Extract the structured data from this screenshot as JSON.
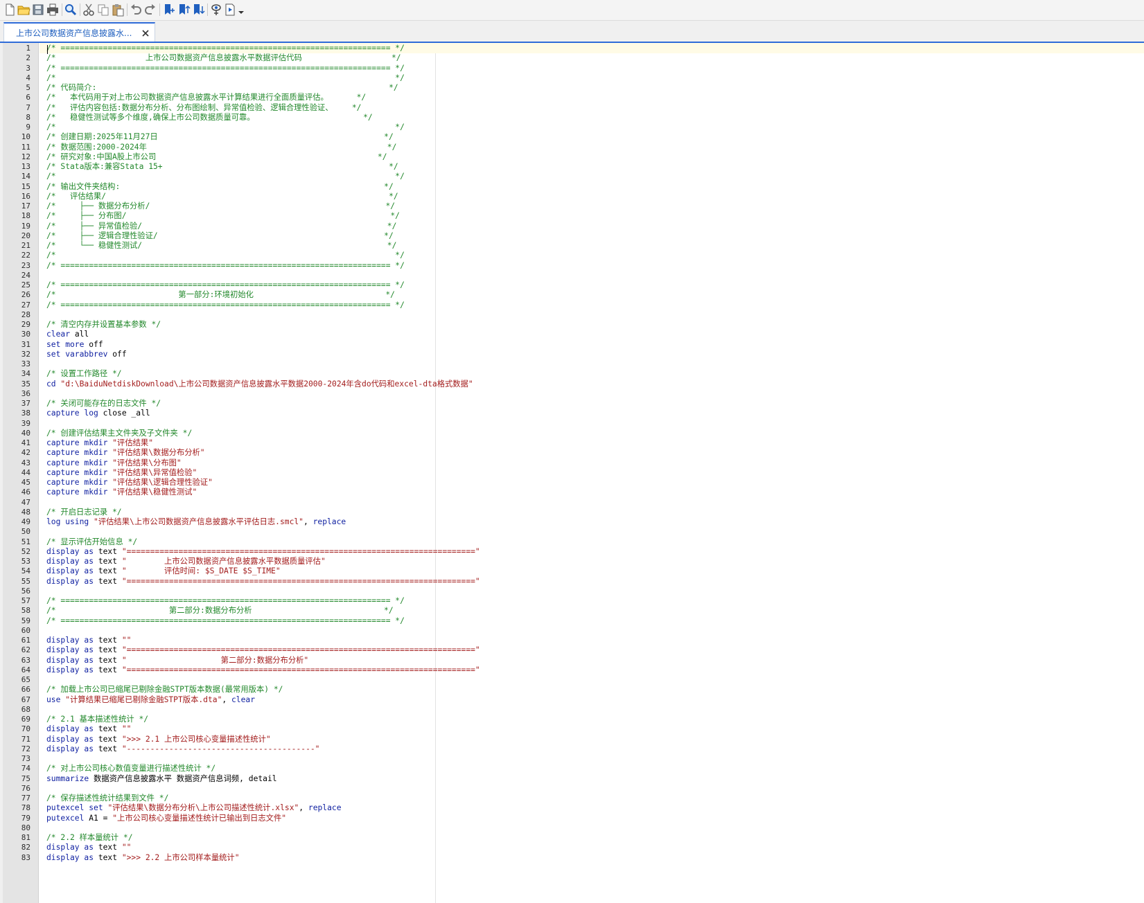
{
  "toolbar": {
    "buttons": [
      {
        "name": "new-file-icon"
      },
      {
        "name": "open-folder-icon"
      },
      {
        "name": "save-icon"
      },
      {
        "name": "print-icon"
      },
      {
        "name": "find-icon"
      },
      {
        "name": "cut-icon"
      },
      {
        "name": "copy-icon"
      },
      {
        "name": "paste-icon"
      },
      {
        "name": "undo-icon"
      },
      {
        "name": "redo-icon"
      },
      {
        "name": "toggle-bookmark-icon"
      },
      {
        "name": "previous-bookmark-icon"
      },
      {
        "name": "next-bookmark-icon"
      },
      {
        "name": "view-data-icon"
      },
      {
        "name": "run-dropdown-icon"
      }
    ]
  },
  "tab": {
    "title": "上市公司数据资产信息披露水...",
    "close_glyph": "✕"
  },
  "colors": {
    "comment": "#22882b",
    "keyword": "#0d1ea0",
    "string": "#a31c1c",
    "plain": "#000000",
    "accent": "#2e6bd8",
    "current_line": "#fffbe6"
  },
  "editor": {
    "lines": [
      {
        "n": "1",
        "segs": [
          {
            "t": "c",
            "v": "/* ====================================================================== */"
          }
        ]
      },
      {
        "n": "2",
        "segs": [
          {
            "t": "c",
            "v": "/*                   上市公司数据资产信息披露水平数据评估代码                   */"
          }
        ]
      },
      {
        "n": "3",
        "segs": [
          {
            "t": "c",
            "v": "/* ====================================================================== */"
          }
        ]
      },
      {
        "n": "4",
        "segs": [
          {
            "t": "c",
            "v": "/*                                                                        */"
          }
        ]
      },
      {
        "n": "5",
        "segs": [
          {
            "t": "c",
            "v": "/* 代码简介:                                                              */"
          }
        ]
      },
      {
        "n": "6",
        "segs": [
          {
            "t": "c",
            "v": "/*   本代码用于对上市公司数据资产信息披露水平计算结果进行全面质量评估。      */"
          }
        ]
      },
      {
        "n": "7",
        "segs": [
          {
            "t": "c",
            "v": "/*   评估内容包括:数据分布分析、分布图绘制、异常值检验、逻辑合理性验证、    */"
          }
        ]
      },
      {
        "n": "8",
        "segs": [
          {
            "t": "c",
            "v": "/*   稳健性测试等多个维度,确保上市公司数据质量可靠。                       */"
          }
        ]
      },
      {
        "n": "9",
        "segs": [
          {
            "t": "c",
            "v": "/*                                                                        */"
          }
        ]
      },
      {
        "n": "10",
        "segs": [
          {
            "t": "c",
            "v": "/* 创建日期:2025年11月27日                                                */"
          }
        ]
      },
      {
        "n": "11",
        "segs": [
          {
            "t": "c",
            "v": "/* 数据范围:2000-2024年                                                   */"
          }
        ]
      },
      {
        "n": "12",
        "segs": [
          {
            "t": "c",
            "v": "/* 研究对象:中国A股上市公司                                               */"
          }
        ]
      },
      {
        "n": "13",
        "segs": [
          {
            "t": "c",
            "v": "/* Stata版本:兼容Stata 15+                                                */"
          }
        ]
      },
      {
        "n": "14",
        "segs": [
          {
            "t": "c",
            "v": "/*                                                                        */"
          }
        ]
      },
      {
        "n": "15",
        "segs": [
          {
            "t": "c",
            "v": "/* 输出文件夹结构:                                                        */"
          }
        ]
      },
      {
        "n": "16",
        "segs": [
          {
            "t": "c",
            "v": "/*   评估结果/                                                            */"
          }
        ]
      },
      {
        "n": "17",
        "segs": [
          {
            "t": "c",
            "v": "/*     ├── 数据分布分析/                                                  */"
          }
        ]
      },
      {
        "n": "18",
        "segs": [
          {
            "t": "c",
            "v": "/*     ├── 分布图/                                                        */"
          }
        ]
      },
      {
        "n": "19",
        "segs": [
          {
            "t": "c",
            "v": "/*     ├── 异常值检验/                                                    */"
          }
        ]
      },
      {
        "n": "20",
        "segs": [
          {
            "t": "c",
            "v": "/*     ├── 逻辑合理性验证/                                                */"
          }
        ]
      },
      {
        "n": "21",
        "segs": [
          {
            "t": "c",
            "v": "/*     └── 稳健性测试/                                                    */"
          }
        ]
      },
      {
        "n": "22",
        "segs": [
          {
            "t": "c",
            "v": "/*                                                                        */"
          }
        ]
      },
      {
        "n": "23",
        "segs": [
          {
            "t": "c",
            "v": "/* ====================================================================== */"
          }
        ]
      },
      {
        "n": "24",
        "segs": []
      },
      {
        "n": "25",
        "segs": [
          {
            "t": "c",
            "v": "/* ====================================================================== */"
          }
        ]
      },
      {
        "n": "26",
        "segs": [
          {
            "t": "c",
            "v": "/*                          第一部分:环境初始化                            */"
          }
        ]
      },
      {
        "n": "27",
        "segs": [
          {
            "t": "c",
            "v": "/* ====================================================================== */"
          }
        ]
      },
      {
        "n": "28",
        "segs": []
      },
      {
        "n": "29",
        "segs": [
          {
            "t": "c",
            "v": "/* 清空内存并设置基本参数 */"
          }
        ]
      },
      {
        "n": "30",
        "segs": [
          {
            "t": "k",
            "v": "clear"
          },
          {
            "t": "p",
            "v": " all"
          }
        ]
      },
      {
        "n": "31",
        "segs": [
          {
            "t": "k",
            "v": "set more"
          },
          {
            "t": "p",
            "v": " off"
          }
        ]
      },
      {
        "n": "32",
        "segs": [
          {
            "t": "k",
            "v": "set varabbrev"
          },
          {
            "t": "p",
            "v": " off"
          }
        ]
      },
      {
        "n": "33",
        "segs": []
      },
      {
        "n": "34",
        "segs": [
          {
            "t": "c",
            "v": "/* 设置工作路径 */"
          }
        ]
      },
      {
        "n": "35",
        "segs": [
          {
            "t": "k",
            "v": "cd"
          },
          {
            "t": "p",
            "v": " "
          },
          {
            "t": "s",
            "v": "\"d:\\BaiduNetdiskDownload\\上市公司数据资产信息披露水平数据2000-2024年含do代码和excel-dta格式数据\""
          }
        ]
      },
      {
        "n": "36",
        "segs": []
      },
      {
        "n": "37",
        "segs": [
          {
            "t": "c",
            "v": "/* 关闭可能存在的日志文件 */"
          }
        ]
      },
      {
        "n": "38",
        "segs": [
          {
            "t": "k",
            "v": "capture log"
          },
          {
            "t": "p",
            "v": " close _all"
          }
        ]
      },
      {
        "n": "39",
        "segs": []
      },
      {
        "n": "40",
        "segs": [
          {
            "t": "c",
            "v": "/* 创建评估结果主文件夹及子文件夹 */"
          }
        ]
      },
      {
        "n": "41",
        "segs": [
          {
            "t": "k",
            "v": "capture mkdir"
          },
          {
            "t": "p",
            "v": " "
          },
          {
            "t": "s",
            "v": "\"评估结果\""
          }
        ]
      },
      {
        "n": "42",
        "segs": [
          {
            "t": "k",
            "v": "capture mkdir"
          },
          {
            "t": "p",
            "v": " "
          },
          {
            "t": "s",
            "v": "\"评估结果\\数据分布分析\""
          }
        ]
      },
      {
        "n": "43",
        "segs": [
          {
            "t": "k",
            "v": "capture mkdir"
          },
          {
            "t": "p",
            "v": " "
          },
          {
            "t": "s",
            "v": "\"评估结果\\分布图\""
          }
        ]
      },
      {
        "n": "44",
        "segs": [
          {
            "t": "k",
            "v": "capture mkdir"
          },
          {
            "t": "p",
            "v": " "
          },
          {
            "t": "s",
            "v": "\"评估结果\\异常值检验\""
          }
        ]
      },
      {
        "n": "45",
        "segs": [
          {
            "t": "k",
            "v": "capture mkdir"
          },
          {
            "t": "p",
            "v": " "
          },
          {
            "t": "s",
            "v": "\"评估结果\\逻辑合理性验证\""
          }
        ]
      },
      {
        "n": "46",
        "segs": [
          {
            "t": "k",
            "v": "capture mkdir"
          },
          {
            "t": "p",
            "v": " "
          },
          {
            "t": "s",
            "v": "\"评估结果\\稳健性测试\""
          }
        ]
      },
      {
        "n": "47",
        "segs": []
      },
      {
        "n": "48",
        "segs": [
          {
            "t": "c",
            "v": "/* 开启日志记录 */"
          }
        ]
      },
      {
        "n": "49",
        "segs": [
          {
            "t": "k",
            "v": "log using"
          },
          {
            "t": "p",
            "v": " "
          },
          {
            "t": "s",
            "v": "\"评估结果\\上市公司数据资产信息披露水平评估日志.smcl\""
          },
          {
            "t": "p",
            "v": ", "
          },
          {
            "t": "k",
            "v": "replace"
          }
        ]
      },
      {
        "n": "50",
        "segs": []
      },
      {
        "n": "51",
        "segs": [
          {
            "t": "c",
            "v": "/* 显示评估开始信息 */"
          }
        ]
      },
      {
        "n": "52",
        "segs": [
          {
            "t": "k",
            "v": "display as"
          },
          {
            "t": "p",
            "v": " text "
          },
          {
            "t": "s",
            "v": "\"==========================================================================\""
          }
        ]
      },
      {
        "n": "53",
        "segs": [
          {
            "t": "k",
            "v": "display as"
          },
          {
            "t": "p",
            "v": " text "
          },
          {
            "t": "s",
            "v": "\"        上市公司数据资产信息披露水平数据质量评估\""
          }
        ]
      },
      {
        "n": "54",
        "segs": [
          {
            "t": "k",
            "v": "display as"
          },
          {
            "t": "p",
            "v": " text "
          },
          {
            "t": "s",
            "v": "\"        评估时间: $S_DATE $S_TIME\""
          }
        ]
      },
      {
        "n": "55",
        "segs": [
          {
            "t": "k",
            "v": "display as"
          },
          {
            "t": "p",
            "v": " text "
          },
          {
            "t": "s",
            "v": "\"==========================================================================\""
          }
        ]
      },
      {
        "n": "56",
        "segs": []
      },
      {
        "n": "57",
        "segs": [
          {
            "t": "c",
            "v": "/* ====================================================================== */"
          }
        ]
      },
      {
        "n": "58",
        "segs": [
          {
            "t": "c",
            "v": "/*                        第二部分:数据分布分析                            */"
          }
        ]
      },
      {
        "n": "59",
        "segs": [
          {
            "t": "c",
            "v": "/* ====================================================================== */"
          }
        ]
      },
      {
        "n": "60",
        "segs": []
      },
      {
        "n": "61",
        "segs": [
          {
            "t": "k",
            "v": "display as"
          },
          {
            "t": "p",
            "v": " text "
          },
          {
            "t": "s",
            "v": "\"\""
          }
        ]
      },
      {
        "n": "62",
        "segs": [
          {
            "t": "k",
            "v": "display as"
          },
          {
            "t": "p",
            "v": " text "
          },
          {
            "t": "s",
            "v": "\"==========================================================================\""
          }
        ]
      },
      {
        "n": "63",
        "segs": [
          {
            "t": "k",
            "v": "display as"
          },
          {
            "t": "p",
            "v": " text "
          },
          {
            "t": "s",
            "v": "\"                    第二部分:数据分布分析\""
          }
        ]
      },
      {
        "n": "64",
        "segs": [
          {
            "t": "k",
            "v": "display as"
          },
          {
            "t": "p",
            "v": " text "
          },
          {
            "t": "s",
            "v": "\"==========================================================================\""
          }
        ]
      },
      {
        "n": "65",
        "segs": []
      },
      {
        "n": "66",
        "segs": [
          {
            "t": "c",
            "v": "/* 加载上市公司已缩尾已剔除金融STPT版本数据(最常用版本) */"
          }
        ]
      },
      {
        "n": "67",
        "segs": [
          {
            "t": "k",
            "v": "use"
          },
          {
            "t": "p",
            "v": " "
          },
          {
            "t": "s",
            "v": "\"计算结果已缩尾已剔除金融STPT版本.dta\""
          },
          {
            "t": "p",
            "v": ", "
          },
          {
            "t": "k",
            "v": "clear"
          }
        ]
      },
      {
        "n": "68",
        "segs": []
      },
      {
        "n": "69",
        "segs": [
          {
            "t": "c",
            "v": "/* 2.1 基本描述性统计 */"
          }
        ]
      },
      {
        "n": "70",
        "segs": [
          {
            "t": "k",
            "v": "display as"
          },
          {
            "t": "p",
            "v": " text "
          },
          {
            "t": "s",
            "v": "\"\""
          }
        ]
      },
      {
        "n": "71",
        "segs": [
          {
            "t": "k",
            "v": "display as"
          },
          {
            "t": "p",
            "v": " text "
          },
          {
            "t": "s",
            "v": "\">>> 2.1 上市公司核心变量描述性统计\""
          }
        ]
      },
      {
        "n": "72",
        "segs": [
          {
            "t": "k",
            "v": "display as"
          },
          {
            "t": "p",
            "v": " text "
          },
          {
            "t": "s",
            "v": "\"----------------------------------------\""
          }
        ]
      },
      {
        "n": "73",
        "segs": []
      },
      {
        "n": "74",
        "segs": [
          {
            "t": "c",
            "v": "/* 对上市公司核心数值变量进行描述性统计 */"
          }
        ]
      },
      {
        "n": "75",
        "segs": [
          {
            "t": "k",
            "v": "summarize"
          },
          {
            "t": "p",
            "v": " 数据资产信息披露水平 数据资产信息词频, detail"
          }
        ]
      },
      {
        "n": "76",
        "segs": []
      },
      {
        "n": "77",
        "segs": [
          {
            "t": "c",
            "v": "/* 保存描述性统计结果到文件 */"
          }
        ]
      },
      {
        "n": "78",
        "segs": [
          {
            "t": "k",
            "v": "putexcel set"
          },
          {
            "t": "p",
            "v": " "
          },
          {
            "t": "s",
            "v": "\"评估结果\\数据分布分析\\上市公司描述性统计.xlsx\""
          },
          {
            "t": "p",
            "v": ", "
          },
          {
            "t": "k",
            "v": "replace"
          }
        ]
      },
      {
        "n": "79",
        "segs": [
          {
            "t": "k",
            "v": "putexcel"
          },
          {
            "t": "p",
            "v": " A1 = "
          },
          {
            "t": "s",
            "v": "\"上市公司核心变量描述性统计已输出到日志文件\""
          }
        ]
      },
      {
        "n": "80",
        "segs": []
      },
      {
        "n": "81",
        "segs": [
          {
            "t": "c",
            "v": "/* 2.2 样本量统计 */"
          }
        ]
      },
      {
        "n": "82",
        "segs": [
          {
            "t": "k",
            "v": "display as"
          },
          {
            "t": "p",
            "v": " text "
          },
          {
            "t": "s",
            "v": "\"\""
          }
        ]
      },
      {
        "n": "83",
        "segs": [
          {
            "t": "k",
            "v": "display as"
          },
          {
            "t": "p",
            "v": " text "
          },
          {
            "t": "s",
            "v": "\">>> 2.2 上市公司样本量统计\""
          }
        ]
      }
    ]
  }
}
